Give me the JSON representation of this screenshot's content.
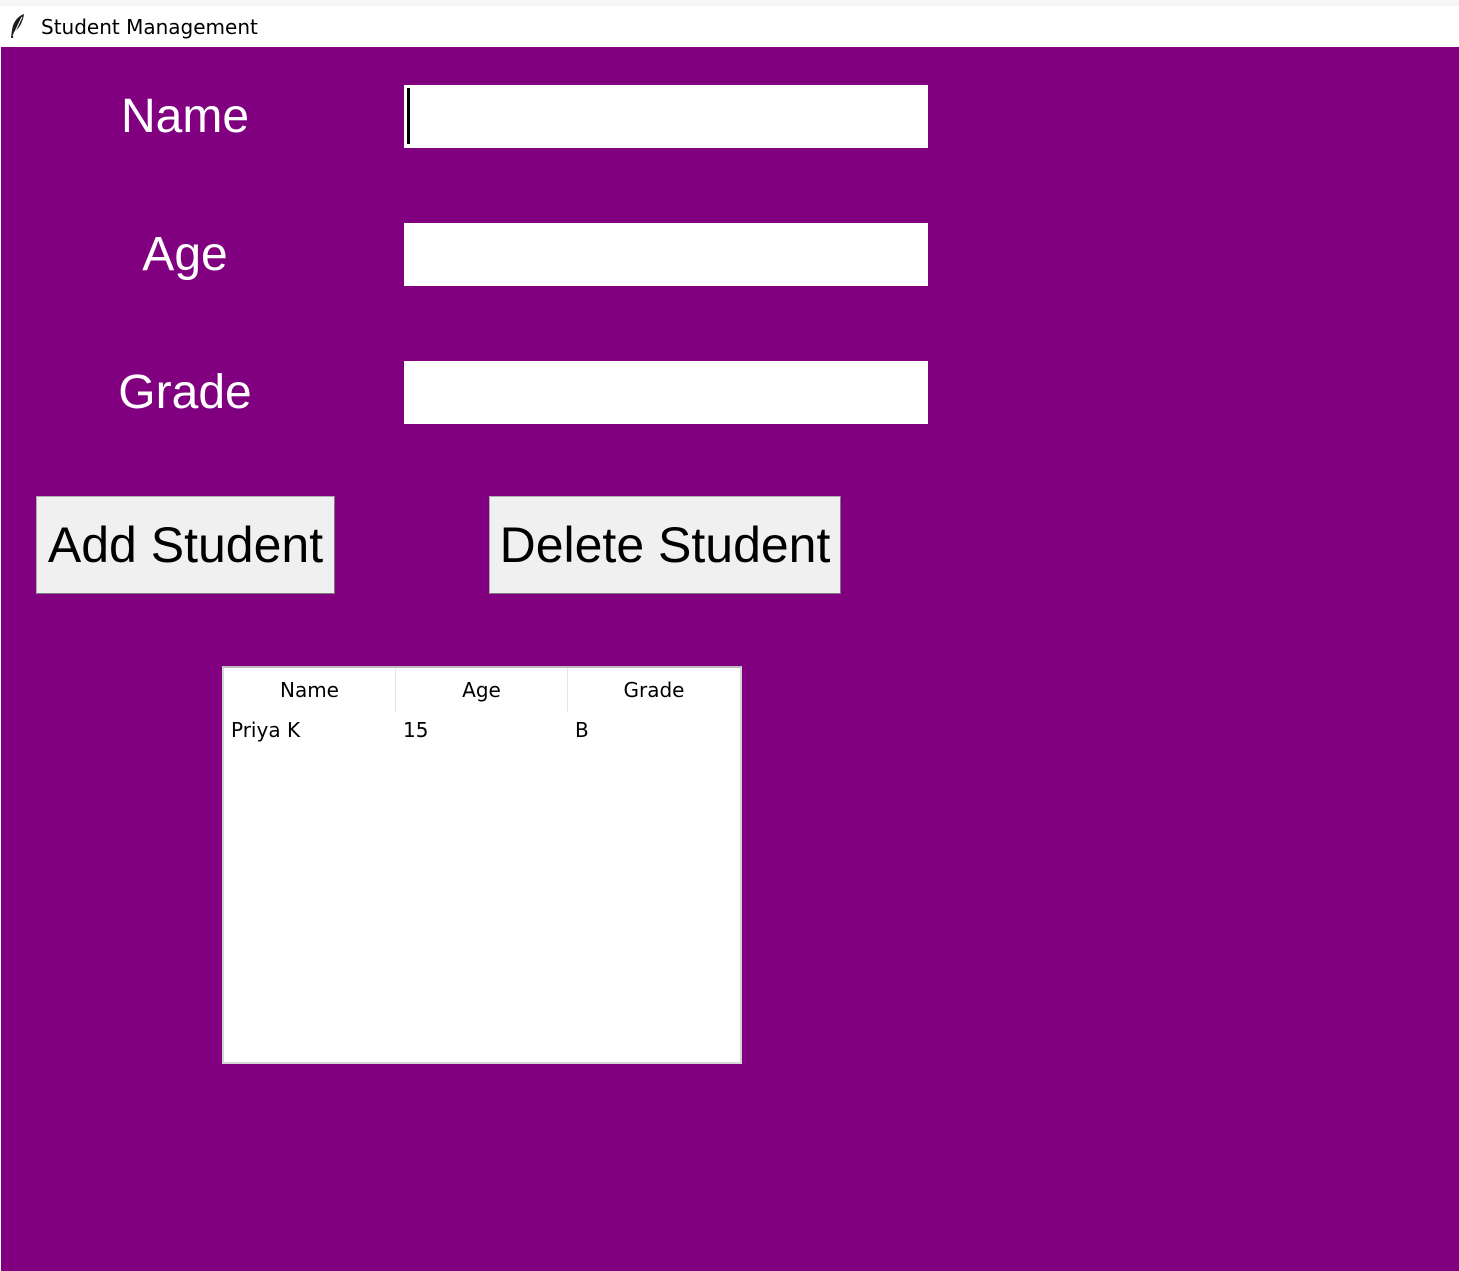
{
  "window": {
    "title": "Student Management",
    "icon": "feather-icon"
  },
  "colors": {
    "background": "#800080",
    "label_text": "#ffffff",
    "button_face": "#f0f0f0",
    "input_bg": "#ffffff"
  },
  "form": {
    "fields": [
      {
        "label": "Name",
        "value": "",
        "focused": true
      },
      {
        "label": "Age",
        "value": ""
      },
      {
        "label": "Grade",
        "value": ""
      }
    ]
  },
  "buttons": {
    "add_label": "Add Student",
    "delete_label": "Delete Student"
  },
  "table": {
    "columns": [
      "Name",
      "Age",
      "Grade"
    ],
    "rows": [
      [
        "Priya K",
        "15",
        "B"
      ]
    ]
  }
}
